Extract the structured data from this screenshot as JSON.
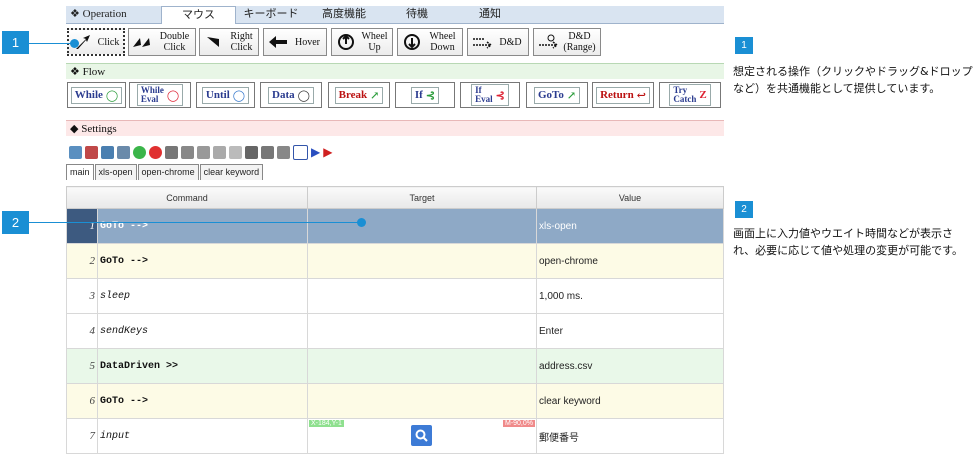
{
  "tabs": [
    "Operation",
    "マウス",
    "キーボード",
    "高度機能",
    "待機",
    "通知"
  ],
  "mouse_buttons": [
    {
      "label": "Click",
      "icon": "click-arrow-icon"
    },
    {
      "label": "Double\nClick",
      "icon": "double-click-icon"
    },
    {
      "label": "Right\nClick",
      "icon": "right-click-icon"
    },
    {
      "label": "Hover",
      "icon": "hover-arrow-icon"
    },
    {
      "label": "Wheel\nUp",
      "icon": "wheel-up-icon"
    },
    {
      "label": "Wheel\nDown",
      "icon": "wheel-down-icon"
    },
    {
      "label": "D&D",
      "icon": "drag-drop-icon"
    },
    {
      "label": "D&D\n(Range)",
      "icon": "drag-drop-range-icon"
    }
  ],
  "flow_title": "Flow",
  "flow_buttons": [
    "While",
    "While\nEval",
    "Until",
    "Data",
    "Break",
    "If",
    "If\nEval",
    "GoTo",
    "Return",
    "Try\nCatch"
  ],
  "settings_title": "Settings",
  "subtabs": [
    "main",
    "xls-open",
    "open-chrome",
    "clear keyword"
  ],
  "grid": {
    "headers": [
      "Command",
      "Target",
      "Value"
    ],
    "rows": [
      {
        "num": "1",
        "cmd": "GoTo -->",
        "target": "",
        "value": "xls-open"
      },
      {
        "num": "2",
        "cmd": "GoTo -->",
        "target": "",
        "value": "open-chrome"
      },
      {
        "num": "3",
        "cmd": "sleep",
        "target": "",
        "value": "1,000 ms."
      },
      {
        "num": "4",
        "cmd": "sendKeys",
        "target": "",
        "value": "Enter"
      },
      {
        "num": "5",
        "cmd": "DataDriven >>",
        "target": "",
        "value": "address.csv"
      },
      {
        "num": "6",
        "cmd": "GoTo -->",
        "target": "",
        "value": "clear keyword"
      },
      {
        "num": "7",
        "cmd": "input",
        "target": "",
        "value": "郵便番号"
      }
    ],
    "row7_badge_left": "X-184,Y-1",
    "row7_badge_right": "M-90,0%"
  },
  "callouts": [
    {
      "num": "1",
      "text": "想定される操作（クリックやドラッグ&ドロップなど）を共通機能として提供しています。"
    },
    {
      "num": "2",
      "text": "画面上に入力値やウエイト時間などが表示され、必要に応じて値や処理の変更が可能です。"
    }
  ]
}
